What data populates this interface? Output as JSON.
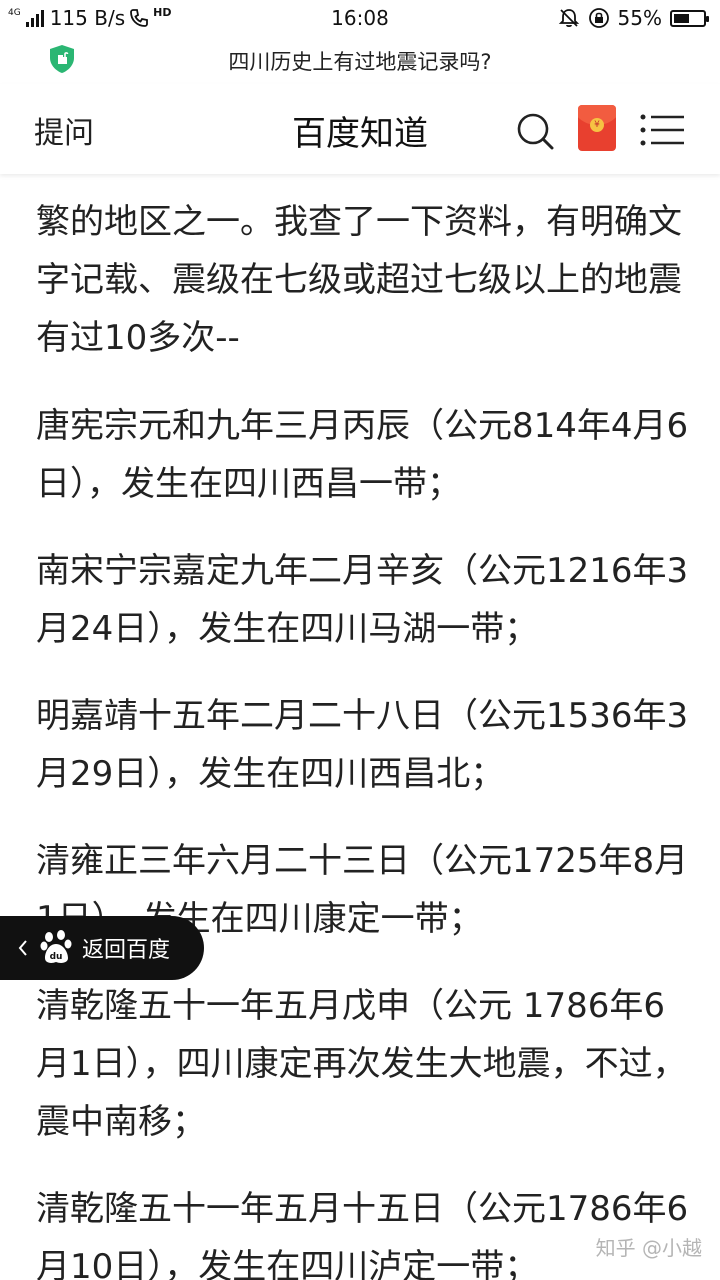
{
  "status_bar": {
    "signal_label": "4G",
    "speed": "115 B/s",
    "hd_label": "HD",
    "time": "16:08",
    "battery": "55%",
    "battery_level": 0.55
  },
  "url_bar": {
    "title": "四川历史上有过地震记录吗?"
  },
  "header": {
    "ask_label": "提问",
    "site_title": "百度知道",
    "redpacket_mark": "¥"
  },
  "article": {
    "paragraphs": [
      "繁的地区之一。我查了一下资料，有明确文字记载、震级在七级或超过七级以上的地震有过10多次--",
      "唐宪宗元和九年三月丙辰（公元814年4月6日），发生在四川西昌一带；",
      "南宋宁宗嘉定九年二月辛亥（公元1216年3月24日），发生在四川马湖一带；",
      "明嘉靖十五年二月二十八日（公元1536年3月29日），发生在四川西昌北；",
      "清雍正三年六月二十三日（公元1725年8月1日），发生在四川康定一带；",
      "清乾隆五十一年五月戊申（公元 1786年6月1日），四川康定再次发生大地震，不过，震中南移；",
      "清乾隆五十一年五月十五日（公元1786年6月10日），发生在四川泸定一带；"
    ]
  },
  "back_button": {
    "label": "返回百度"
  },
  "watermark": "知乎 @小越",
  "colors": {
    "shield": "#2bb673",
    "redpacket": "#e8402f",
    "back_pill": "#111111"
  }
}
